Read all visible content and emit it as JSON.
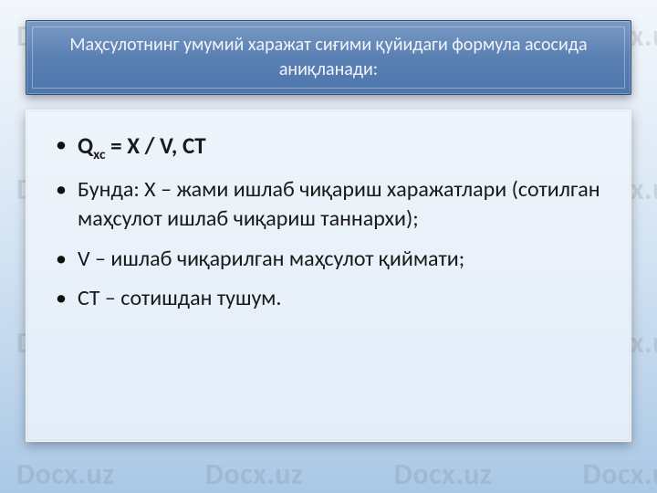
{
  "watermark": "Docx.uz",
  "title": "Маҳсулотнинг умумий харажат сиғими қуйидаги формула асосида аниқланади:",
  "bullets": {
    "b1": {
      "prefix": "Q",
      "sub": "хс",
      "rest": " = Х / V, СТ"
    },
    "b2": "Бунда: Х – жами ишлаб чиқариш харажатлари (сотилган маҳсулот ишлаб чиқариш таннархи);",
    "b3": "V – ишлаб чиқарилган маҳсулот қиймати;",
    "b4": "СТ – сотишдан тушум."
  }
}
